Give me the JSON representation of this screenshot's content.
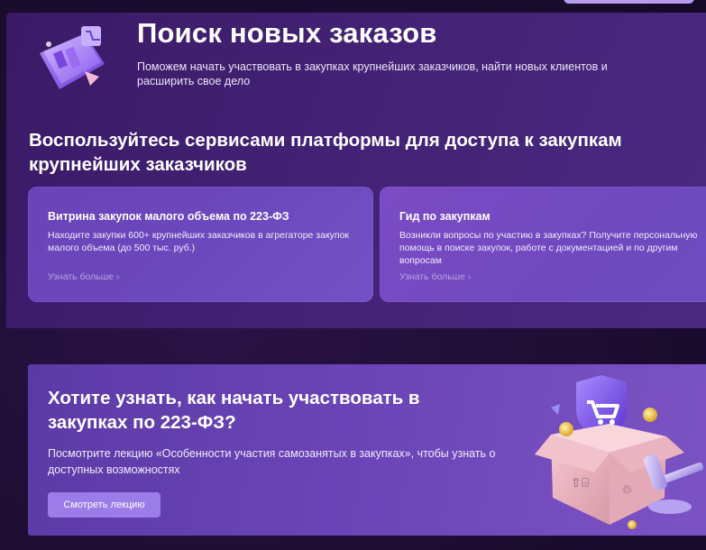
{
  "hero": {
    "title": "Поиск новых заказов",
    "subtitle": "Поможем начать участвовать в закупках крупнейших заказчиков, найти новых клиентов и расширить свое дело"
  },
  "services": {
    "heading": "Воспользуйтесь сервисами платформы для доступа к закупкам крупнейших заказчиков",
    "cards": [
      {
        "title": "Витрина закупок малого объема по 223-ФЗ",
        "text": "Находите закупки 600+ крупнейших заказчиков в агрегаторе закупок малого объема (до 500 тыс. руб.)",
        "link": "Узнать больше ›"
      },
      {
        "title": "Гид по закупкам",
        "text": "Возникли вопросы по участию в закупках? Получите персональную помощь в поиске закупок, работе с документацией и по другим вопросам",
        "link": "Узнать больше ›"
      }
    ]
  },
  "lecture": {
    "title": "Хотите узнать, как начать участвовать в закупках по 223-ФЗ?",
    "text": "Посмотрите лекцию «Особенности участия самозанятых в закупках», чтобы узнать о доступных возможностях",
    "button_label": "Смотреть лекцию"
  },
  "icons": {
    "hero_illustration": "purchase-window-illustration-icon",
    "lecture_illustration": "shopping-box-gavel-illustration-icon",
    "top_button": "top-pill-button"
  },
  "colors": {
    "background": "#1f1034",
    "hero": "#432275",
    "card": "#6c48bd",
    "lecture": "#6a44b6",
    "button": "#9c7ce8",
    "link": "#b8a4e3"
  }
}
